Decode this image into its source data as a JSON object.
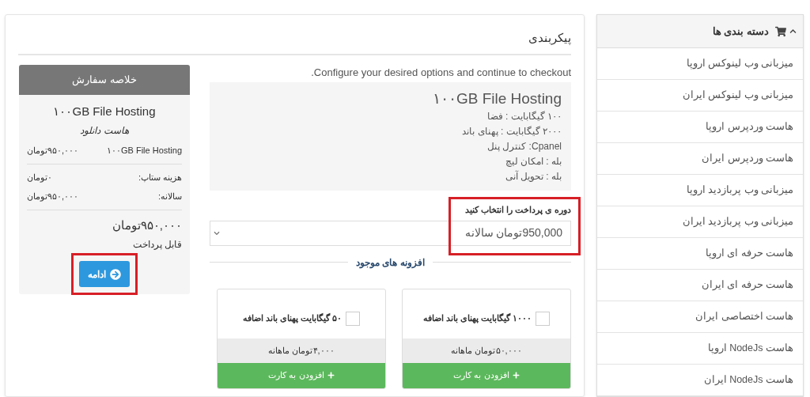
{
  "sidebar": {
    "title": "دسته بندی ها",
    "expanded": true,
    "items": [
      {
        "label": "میزبانی وب لینوکس اروپا"
      },
      {
        "label": "میزبانی وب لینوکس ایران"
      },
      {
        "label": "هاست وردپرس اروپا"
      },
      {
        "label": "هاست وردپرس ایران"
      },
      {
        "label": "میزبانی وب پربازدید اروپا"
      },
      {
        "label": "میزبانی وب پربازدید ایران"
      },
      {
        "label": "هاست حرفه ای اروپا"
      },
      {
        "label": "هاست حرفه ای ایران"
      },
      {
        "label": "هاست اختصاصی ایران"
      },
      {
        "label": "هاست NodeJs اروپا"
      },
      {
        "label": "هاست NodeJs ایران"
      }
    ]
  },
  "page_title": "پیکربندی",
  "intro": "Configure your desired options and continue to checkout.",
  "product": {
    "name": "۱۰۰GB File Hosting",
    "features": [
      "۱۰۰ گیگابایت : فضا",
      "۲۰۰۰ گیگابایت : پهنای باند",
      "Cpanel: کنترل پنل",
      "بله : امکان لیچ",
      "بله : تحویل آنی"
    ]
  },
  "billing": {
    "label": "دوره ی پرداخت را انتخاب کنید",
    "value": "950,000تومان سالانه",
    "highlighted": true
  },
  "addons_title": "افزونه های موجود",
  "addons": [
    {
      "label": "۱۰۰۰ گیگابایت پهنای باند اضافه",
      "checked": false,
      "price": "۵۰,۰۰۰تومان ماهانه",
      "button": "افزودن به کارت"
    },
    {
      "label": "۵۰ گیگابایت پهنای باند اضافه",
      "checked": false,
      "price": "۴,۰۰۰تومان ماهانه",
      "button": "افزودن به کارت"
    }
  ],
  "summary": {
    "title": "خلاصه سفارش",
    "product": "۱۰۰GB File Hosting",
    "group": "هاست دانلود",
    "line": {
      "label": "۱۰۰GB File Hosting",
      "value": "۹۵۰,۰۰۰تومان"
    },
    "rows": [
      {
        "label": "هزینه ستاپ:",
        "value": "۰تومان"
      },
      {
        "label": "سالانه:",
        "value": "۹۵۰,۰۰۰تومان"
      }
    ],
    "total": "۹۵۰,۰۰۰تومان",
    "total_label": "قابل پرداخت",
    "button": {
      "label": "ادامه",
      "highlighted": true
    }
  }
}
